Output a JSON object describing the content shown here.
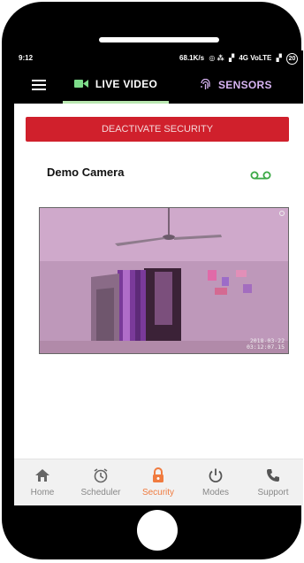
{
  "status_bar": {
    "time": "9:12",
    "speed": "68.1K/s",
    "network": "4G VoLTE",
    "battery": "20"
  },
  "top_nav": {
    "tabs": [
      {
        "label": "LIVE VIDEO",
        "icon": "video-camera-icon",
        "active": true
      },
      {
        "label": "SENSORS",
        "icon": "fingerprint-icon",
        "active": false
      }
    ]
  },
  "security": {
    "deactivate_label": "DEACTIVATE SECURITY"
  },
  "camera": {
    "name": "Demo Camera",
    "timestamp_date": "2018-03-22",
    "timestamp_time": "03:12:07.15"
  },
  "bottom_nav": {
    "items": [
      {
        "label": "Home",
        "icon": "home-icon"
      },
      {
        "label": "Scheduler",
        "icon": "scheduler-icon"
      },
      {
        "label": "Security",
        "icon": "lock-icon",
        "active": true
      },
      {
        "label": "Modes",
        "icon": "power-icon"
      },
      {
        "label": "Support",
        "icon": "phone-icon"
      }
    ]
  },
  "colors": {
    "accent_red": "#d0202c",
    "active_orange": "#f07b3f",
    "record_green": "#3aa845",
    "sensors_purple": "#d8b4f3"
  }
}
